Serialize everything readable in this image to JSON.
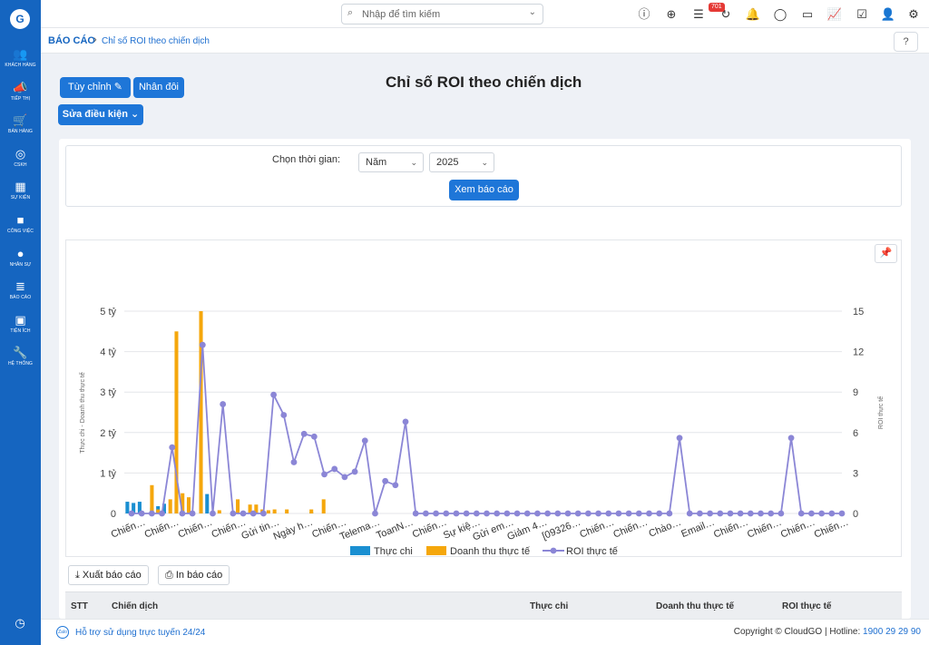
{
  "app": {
    "logo": "G"
  },
  "sidebar": {
    "items": [
      {
        "label": "Khách hàng",
        "icon": "users-icon",
        "glyph": "👥"
      },
      {
        "label": "Tiếp thị",
        "icon": "megaphone-icon",
        "glyph": "📣"
      },
      {
        "label": "Bán hàng",
        "icon": "cart-icon",
        "glyph": "🛒"
      },
      {
        "label": "CSKH",
        "icon": "lifebuoy-icon",
        "glyph": "◎"
      },
      {
        "label": "Sự kiện",
        "icon": "calendar-icon",
        "glyph": "▦"
      },
      {
        "label": "Công việc",
        "icon": "briefcase-icon",
        "glyph": "■"
      },
      {
        "label": "Nhân sự",
        "icon": "person-icon",
        "glyph": "●"
      },
      {
        "label": "Báo cáo",
        "icon": "report-icon",
        "glyph": "≣"
      },
      {
        "label": "Tiện ích",
        "icon": "gift-icon",
        "glyph": "▣"
      },
      {
        "label": "Hệ thống",
        "icon": "wrench-icon",
        "glyph": "🔧"
      }
    ],
    "history_glyph": "◷"
  },
  "topbar": {
    "search_placeholder": "Nhập để tìm kiếm",
    "notification_count": "701"
  },
  "breadcrumb": {
    "root": "BÁO CÁO",
    "separator": "›",
    "current": "Chỉ số ROI theo chiến dịch"
  },
  "toolbar": {
    "customize_label": "Tùy chỉnh ✎",
    "duplicate_label": "Nhân đôi",
    "edit_condition_label": "Sửa điều kiện ⌄"
  },
  "page": {
    "title": "Chỉ số ROI theo chiến dịch"
  },
  "filter": {
    "time_label": "Chọn thời gian:",
    "period_value": "Năm",
    "year_value": "2025",
    "view_button": "Xem báo cáo"
  },
  "actions": {
    "export_label": "⤓ Xuất báo cáo",
    "print_label": "⎙ In báo cáo"
  },
  "table": {
    "columns": [
      "STT",
      "Chiến dịch",
      "Thực chi",
      "Doanh thu thực tế",
      "ROI thực tế"
    ]
  },
  "footer": {
    "support": "Hỗ trợ sử dụng trực tuyến 24/24",
    "copyright": "Copyright © CloudGO | Hotline: ",
    "hotline": "1900 29 29 90"
  },
  "colors": {
    "spend": "#1a8fd1",
    "revenue": "#f5a70c",
    "roi": "#8b86d6",
    "brand": "#1565c0"
  },
  "chart_data": {
    "type": "bar",
    "title": "",
    "ylabel": "Thực chi - Doanh thu thực tế",
    "y2label": "ROI thực tế",
    "ylim": [
      0,
      5000000000
    ],
    "y2lim": [
      0,
      15
    ],
    "yticks": [
      "0",
      "1 tỷ",
      "2 tỷ",
      "3 tỷ",
      "4 tỷ",
      "5 tỷ"
    ],
    "y2ticks": [
      "0",
      "3",
      "6",
      "9",
      "12",
      "15"
    ],
    "xtick_labels": [
      "Chiến…",
      "Chiến…",
      "Chiến…",
      "Chiến…",
      "Gửi tin…",
      "Ngày h…",
      "Chiến…",
      "Telema…",
      "ToanN…",
      "Chiến…",
      "Sự kiệ…",
      "Gửi em…",
      "Giảm 4…",
      "[09326…",
      "Chiến…",
      "Chiến…",
      "Chào…",
      "Email…",
      "Chiến…",
      "Chiến…",
      "Chiến…",
      "Chiến…"
    ],
    "legend": [
      "Thực chi",
      "Doanh thu thực tế",
      "ROI thực tế"
    ],
    "legend_position": "bottom",
    "series": [
      {
        "name": "Thực chi",
        "kind": "bar",
        "values": [
          290000000,
          260000000,
          290000000,
          0,
          140000000,
          180000000,
          240000000,
          0,
          300000000,
          0,
          300000000,
          0,
          430000000,
          480000000,
          0,
          0,
          0,
          0,
          0,
          20000000,
          0,
          0,
          0,
          0,
          0,
          0,
          0,
          0,
          0,
          0,
          30000000,
          0,
          0,
          0,
          0,
          0,
          0,
          0,
          0,
          0,
          0,
          0,
          0,
          0,
          0,
          0,
          0,
          0,
          0,
          0,
          0,
          0,
          0,
          0,
          0,
          0,
          0,
          0,
          0,
          0,
          0,
          0,
          0,
          0,
          0,
          0,
          0,
          0,
          0,
          0,
          0,
          0,
          0,
          0,
          0,
          0,
          0,
          0,
          0,
          0,
          0,
          0,
          0,
          0,
          0,
          0,
          0,
          0,
          0,
          0,
          0,
          0,
          0,
          0,
          0,
          0,
          0,
          0,
          0,
          0,
          0,
          0,
          0,
          0,
          0,
          0,
          0,
          0,
          0,
          0,
          0,
          0,
          0,
          0,
          0,
          0,
          0
        ]
      },
      {
        "name": "Doanh thu thực tế",
        "kind": "bar",
        "values": [
          0,
          0,
          0,
          0,
          700000000,
          100000000,
          0,
          350000000,
          4500000000,
          500000000,
          400000000,
          0,
          5000000000,
          0,
          0,
          80000000,
          0,
          0,
          350000000,
          0,
          220000000,
          220000000,
          100000000,
          80000000,
          100000000,
          0,
          100000000,
          0,
          0,
          0,
          100000000,
          0,
          350000000,
          0,
          0,
          0,
          0,
          0,
          0,
          0,
          0,
          0,
          0,
          0,
          0,
          0,
          0,
          0,
          0,
          0,
          0,
          0,
          0,
          0,
          0,
          0,
          0,
          0,
          0,
          0,
          0,
          0,
          0,
          0,
          0,
          0,
          0,
          0,
          0,
          0,
          0,
          0,
          0,
          0,
          0,
          0,
          0,
          0,
          0,
          0,
          0,
          0,
          0,
          0,
          0,
          0,
          0,
          0,
          0,
          0,
          0,
          0,
          0,
          0,
          0,
          0,
          0,
          0,
          0,
          0,
          0,
          0,
          0,
          0,
          0,
          0,
          0,
          0,
          0,
          0,
          0,
          0,
          0,
          0,
          0,
          0,
          0,
          0,
          0
        ]
      },
      {
        "name": "ROI thực tế",
        "kind": "line",
        "values": [
          0,
          0,
          0,
          0,
          4.9,
          0,
          0,
          12.5,
          0,
          8.1,
          0,
          0,
          0,
          0,
          8.8,
          7.3,
          3.8,
          5.9,
          5.7,
          2.9,
          3.3,
          2.7,
          3.1,
          5.4,
          0,
          2.4,
          2.1,
          6.8,
          0,
          0,
          0,
          0,
          0,
          0,
          0,
          0,
          0,
          0,
          0,
          0,
          0,
          0,
          0,
          0,
          0,
          0,
          0,
          0,
          0,
          0,
          0,
          0,
          0,
          0,
          5.6,
          0,
          0,
          0,
          0,
          0,
          0,
          0,
          0,
          0,
          0,
          5.6,
          0,
          0,
          0,
          0,
          0
        ]
      }
    ]
  }
}
